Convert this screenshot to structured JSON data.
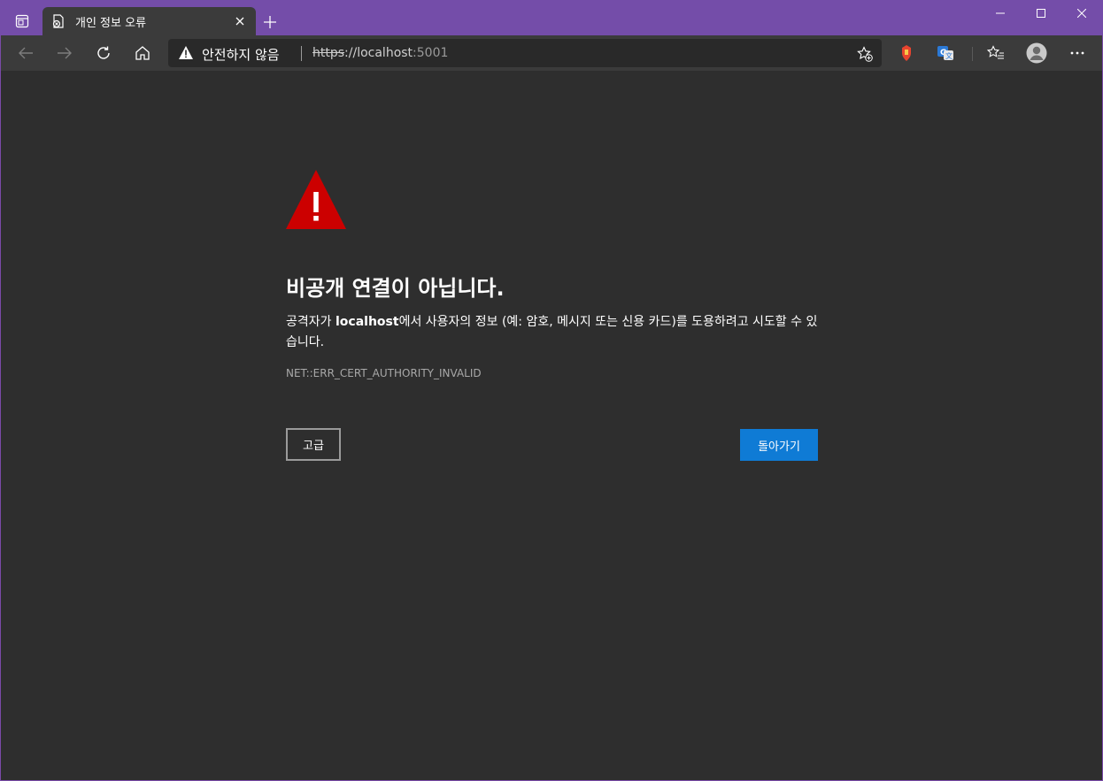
{
  "window": {
    "tab_title": "개인 정보 오류",
    "controls": [
      "minimize",
      "maximize",
      "close"
    ]
  },
  "toolbar": {
    "security_label": "안전하지 않음",
    "url_scheme": "https",
    "url_host": "://localhost",
    "url_port": ":5001"
  },
  "page": {
    "heading": "비공개 연결이 아닙니다.",
    "desc_before": "공격자가 ",
    "desc_host": "localhost",
    "desc_after": "에서 사용자의 정보 (예: 암호, 메시지 또는 신용 카드)를 도용하려고 시도할 수 있습니다.",
    "error_code": "NET::ERR_CERT_AUTHORITY_INVALID",
    "advanced_button": "고급",
    "back_button": "돌아가기"
  },
  "colors": {
    "titlebar": "#744da9",
    "toolbar": "#3b3b3b",
    "page_bg": "#2e2e2e",
    "warning_red": "#cc0000",
    "primary_button": "#0f7bd5"
  }
}
